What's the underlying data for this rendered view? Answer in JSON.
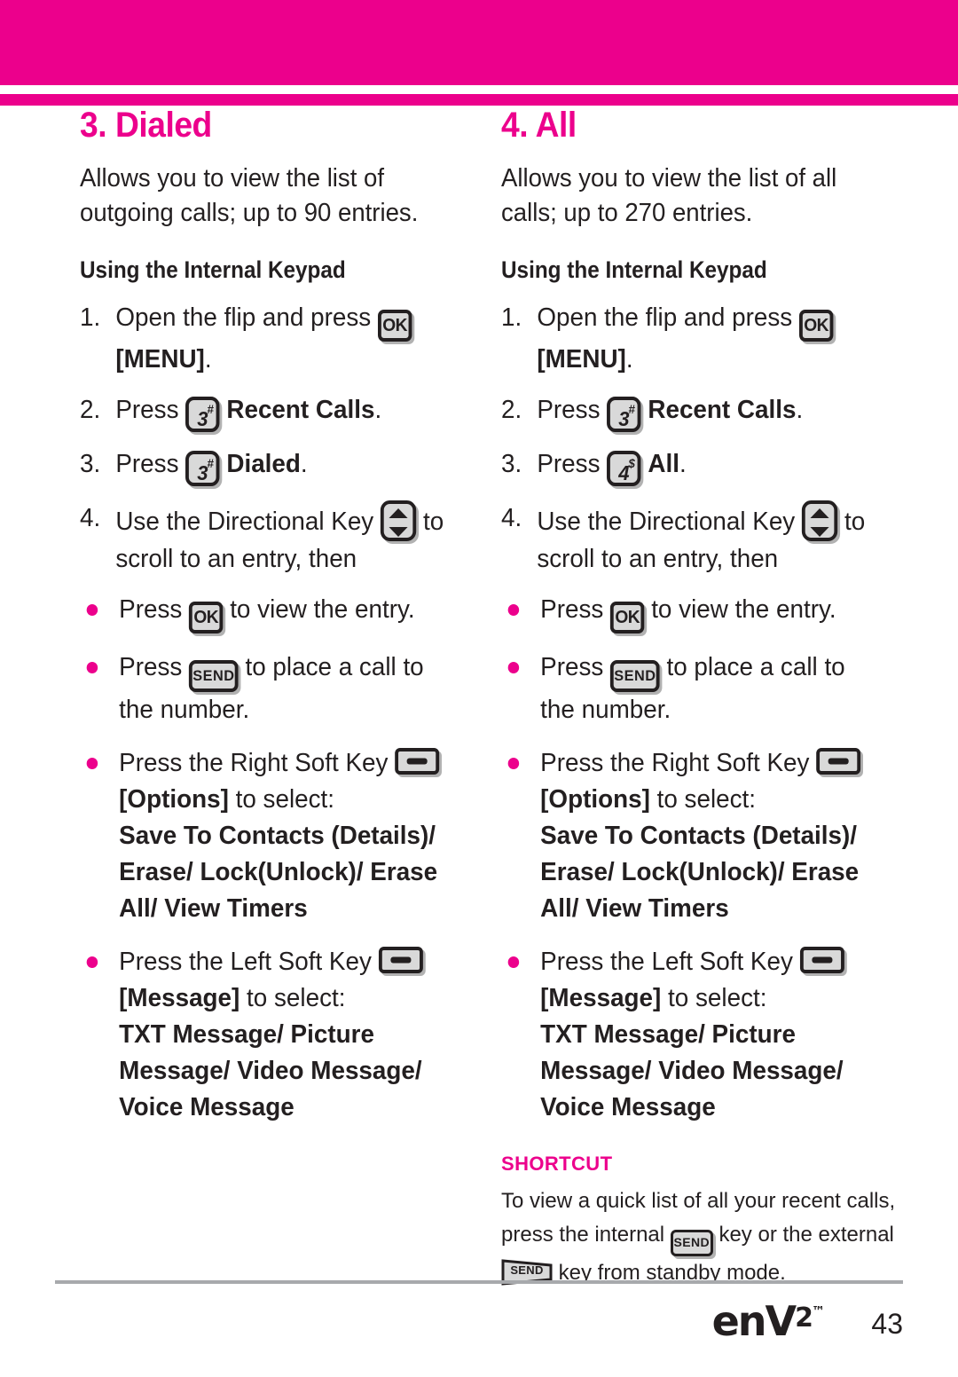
{
  "colors": {
    "accent": "#ec008c",
    "text": "#231f20",
    "key_face": "#d9d9d9",
    "rule": "#a7a9ac"
  },
  "columns": [
    {
      "title": "3. Dialed",
      "intro": "Allows you to view the list of outgoing calls; up to 90 entries.",
      "subtitle": "Using the Internal Keypad",
      "steps": [
        {
          "num": "1.",
          "text_before": "Open the flip and press ",
          "key": "ok-key",
          "key_label": "OK",
          "text_after_bold": "[MENU]",
          "text_after": "."
        },
        {
          "num": "2.",
          "text_before": "Press ",
          "key": "number-key",
          "key_digit": "3",
          "key_sup": "#",
          "text_after_bold": "Recent Calls",
          "text_after": "."
        },
        {
          "num": "3.",
          "text_before": "Press ",
          "key": "number-key",
          "key_digit": "3",
          "key_sup": "#",
          "text_after_bold": "Dialed",
          "text_after": "."
        },
        {
          "num": "4.",
          "text_before": "Use the Directional Key ",
          "key": "directional-key",
          "text_after": " to scroll to an entry, then"
        }
      ],
      "bullets": [
        {
          "text_before": "Press ",
          "key": "ok-key",
          "key_label": "OK",
          "text_after": " to view the entry."
        },
        {
          "text_before": "Press ",
          "key": "send-key",
          "key_label": "SEND",
          "text_after": " to place a call to the number."
        },
        {
          "text_before": "Press the Right Soft Key ",
          "key": "soft-key",
          "bracket": "[Options]",
          "text_after": " to select:",
          "options": "Save To Contacts (Details)/ Erase/ Lock(Unlock)/ Erase All/ View Timers"
        },
        {
          "text_before": "Press the Left Soft Key ",
          "key": "soft-key",
          "bracket": "[Message]",
          "text_after": " to select:",
          "options": "TXT Message/ Picture Message/ Video Message/ Voice Message"
        }
      ],
      "shortcut": null
    },
    {
      "title": "4. All",
      "intro": "Allows you to view the list of all calls; up to 270 entries.",
      "subtitle": "Using the Internal Keypad",
      "steps": [
        {
          "num": "1.",
          "text_before": "Open the flip and press ",
          "key": "ok-key",
          "key_label": "OK",
          "text_after_bold": "[MENU]",
          "text_after": "."
        },
        {
          "num": "2.",
          "text_before": "Press ",
          "key": "number-key",
          "key_digit": "3",
          "key_sup": "#",
          "text_after_bold": "Recent Calls",
          "text_after": "."
        },
        {
          "num": "3.",
          "text_before": "Press ",
          "key": "number-key",
          "key_digit": "4",
          "key_sup": "$",
          "text_after_bold": "All",
          "text_after": "."
        },
        {
          "num": "4.",
          "text_before": "Use the Directional Key ",
          "key": "directional-key",
          "text_after": " to scroll to an entry, then"
        }
      ],
      "bullets": [
        {
          "text_before": "Press ",
          "key": "ok-key",
          "key_label": "OK",
          "text_after": " to view the entry."
        },
        {
          "text_before": "Press ",
          "key": "send-key",
          "key_label": "SEND",
          "text_after": " to place a call to the number."
        },
        {
          "text_before": "Press the Right Soft Key ",
          "key": "soft-key",
          "bracket": "[Options]",
          "text_after": " to select:",
          "options": "Save To Contacts (Details)/ Erase/ Lock(Unlock)/ Erase All/ View Timers"
        },
        {
          "text_before": "Press the Left Soft Key ",
          "key": "soft-key",
          "bracket": "[Message]",
          "text_after": " to select:",
          "options": "TXT Message/ Picture Message/ Video Message/ Voice Message"
        }
      ],
      "shortcut": {
        "title": "SHORTCUT",
        "part1": "To view a quick list of all your recent calls, press the internal ",
        "key_internal_label": "SEND",
        "part2": " key or the external ",
        "key_external_label": "SEND",
        "part3": " key from standby mode."
      }
    }
  ],
  "footer": {
    "logo_text": "enV",
    "logo_superscript": "2",
    "logo_tm": "™",
    "page_number": "43"
  }
}
